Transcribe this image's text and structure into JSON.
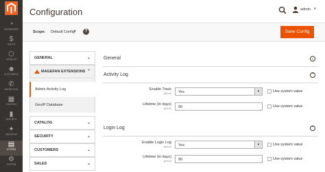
{
  "nav": {
    "items": [
      {
        "label": "DASHBOARD",
        "glyph": "◔",
        "icon": "dashboard-icon"
      },
      {
        "label": "SALES",
        "glyph": "$",
        "icon": "dollar-icon"
      },
      {
        "label": "CATALOG",
        "glyph": "⬡",
        "icon": "box-icon"
      },
      {
        "label": "CUSTOMERS",
        "glyph": "☻",
        "icon": "person-icon"
      },
      {
        "label": "MARKETING",
        "glyph": "✆",
        "icon": "megaphone-icon"
      },
      {
        "label": "CONTENT",
        "glyph": "▦",
        "icon": "content-icon"
      },
      {
        "label": "REPORTS",
        "glyph": "▮",
        "icon": "bar-chart-icon"
      },
      {
        "label": "MAGEFAN",
        "glyph": "✦",
        "icon": "magefan-icon"
      },
      {
        "label": "STORES",
        "glyph": "▤",
        "icon": "store-icon"
      },
      {
        "label": "SYSTEM",
        "glyph": "⚙",
        "icon": "gear-icon"
      }
    ]
  },
  "header": {
    "title": "Configuration",
    "user": "admin"
  },
  "scope": {
    "label": "Scope:",
    "value": "Default Config",
    "help": "?"
  },
  "actions": {
    "save_label": "Save Config"
  },
  "tabs": [
    {
      "label": "GENERAL"
    },
    {
      "label": "MAGEFAN EXTENSIONS"
    },
    {
      "label": "CATALOG"
    },
    {
      "label": "SECURITY"
    },
    {
      "label": "CUSTOMERS"
    },
    {
      "label": "SALES"
    }
  ],
  "subitems": [
    {
      "label": "Admin Activity Log"
    },
    {
      "label": "GeoIP Database"
    }
  ],
  "sections": {
    "general": {
      "title": "General"
    },
    "activity": {
      "title": "Activity Log",
      "enable_track": {
        "label": "Enable Track",
        "scope": "[global]",
        "value": "Yes"
      },
      "lifetime": {
        "label": "Lifetime (in days)",
        "scope": "[global]",
        "value": "90"
      }
    },
    "login": {
      "title": "Login Log",
      "enable_login": {
        "label": "Enable Login Log",
        "scope": "[global]",
        "value": "Yes"
      },
      "lifetime": {
        "label": "Lifetime (in days)",
        "scope": "[global]",
        "value": "90"
      }
    }
  },
  "system_value_label": "Use system value",
  "colors": {
    "accent": "#eb5202",
    "nav_bg": "#373330",
    "logo": "#f26322"
  }
}
